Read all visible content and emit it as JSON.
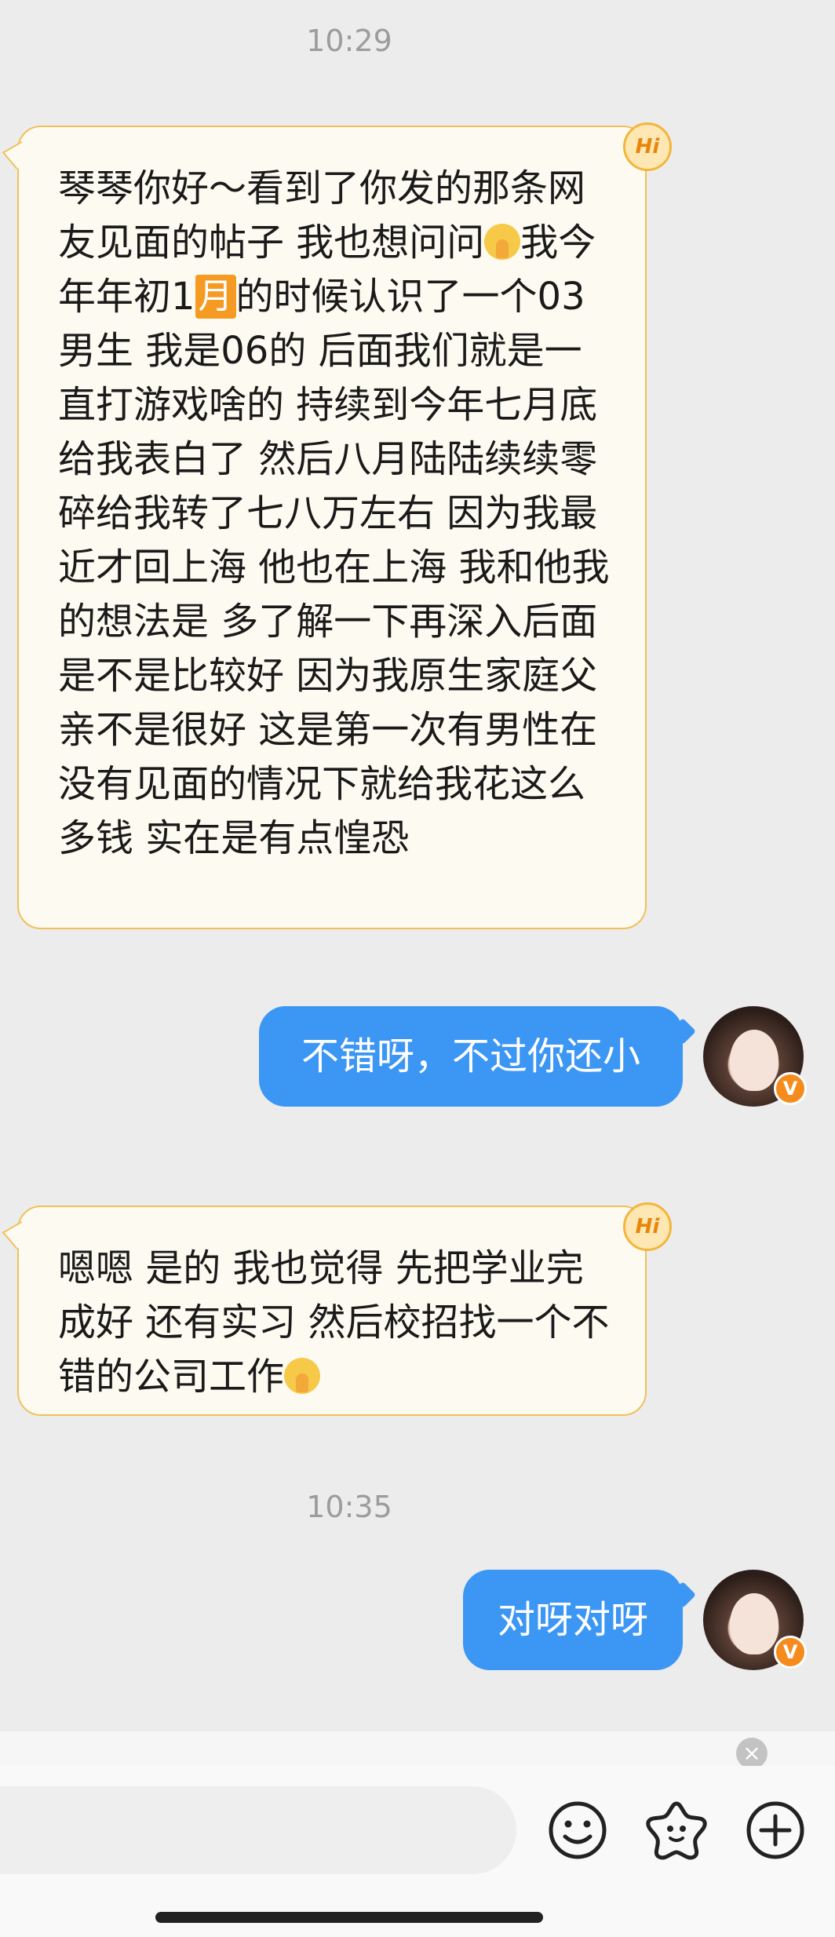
{
  "timestamps": [
    "10:29",
    "10:35"
  ],
  "messages": [
    {
      "side": "incoming",
      "badge": "Hi",
      "text_before_badge": "琴琴你好～看到了你发的那条网友见面的帖子 我也想问问",
      "text_mid": "我今年年初1",
      "month_badge": "月",
      "text_after": "的时候认识了一个03男生 我是06的 后面我们就是一直打游戏啥的 持续到今年七月底 给我表白了 然后八月陆陆续续零碎给我转了七八万左右 因为我最近才回上海 他也在上海 我和他我的想法是 多了解一下再深入后面是不是比较好 因为我原生家庭父亲不是很好 这是第一次有男性在没有见面的情况下就给我花这么多钱 实在是有点惶恐"
    },
    {
      "side": "outgoing",
      "text": "不错呀，不过你还小",
      "avatar_badge": "V"
    },
    {
      "side": "incoming",
      "badge": "Hi",
      "text": "嗯嗯 是的 我也觉得 先把学业完成好 还有实习 然后校招找一个不错的公司工作"
    },
    {
      "side": "outgoing",
      "text": "对呀对呀",
      "avatar_badge": "V"
    }
  ],
  "icons": {
    "emoji_pray": "pleading-pray-emoji",
    "close": "close-icon",
    "emoji_button": "smiley-face-icon",
    "sticker_button": "sticker-star-icon",
    "more_button": "plus-circle-icon"
  },
  "colors": {
    "incoming_bg": "#fdfaf1",
    "incoming_border": "#f0c15a",
    "outgoing_bg": "#3c96f4",
    "badge_orange": "#f58b1c"
  },
  "composer": {
    "close_glyph": "×"
  }
}
